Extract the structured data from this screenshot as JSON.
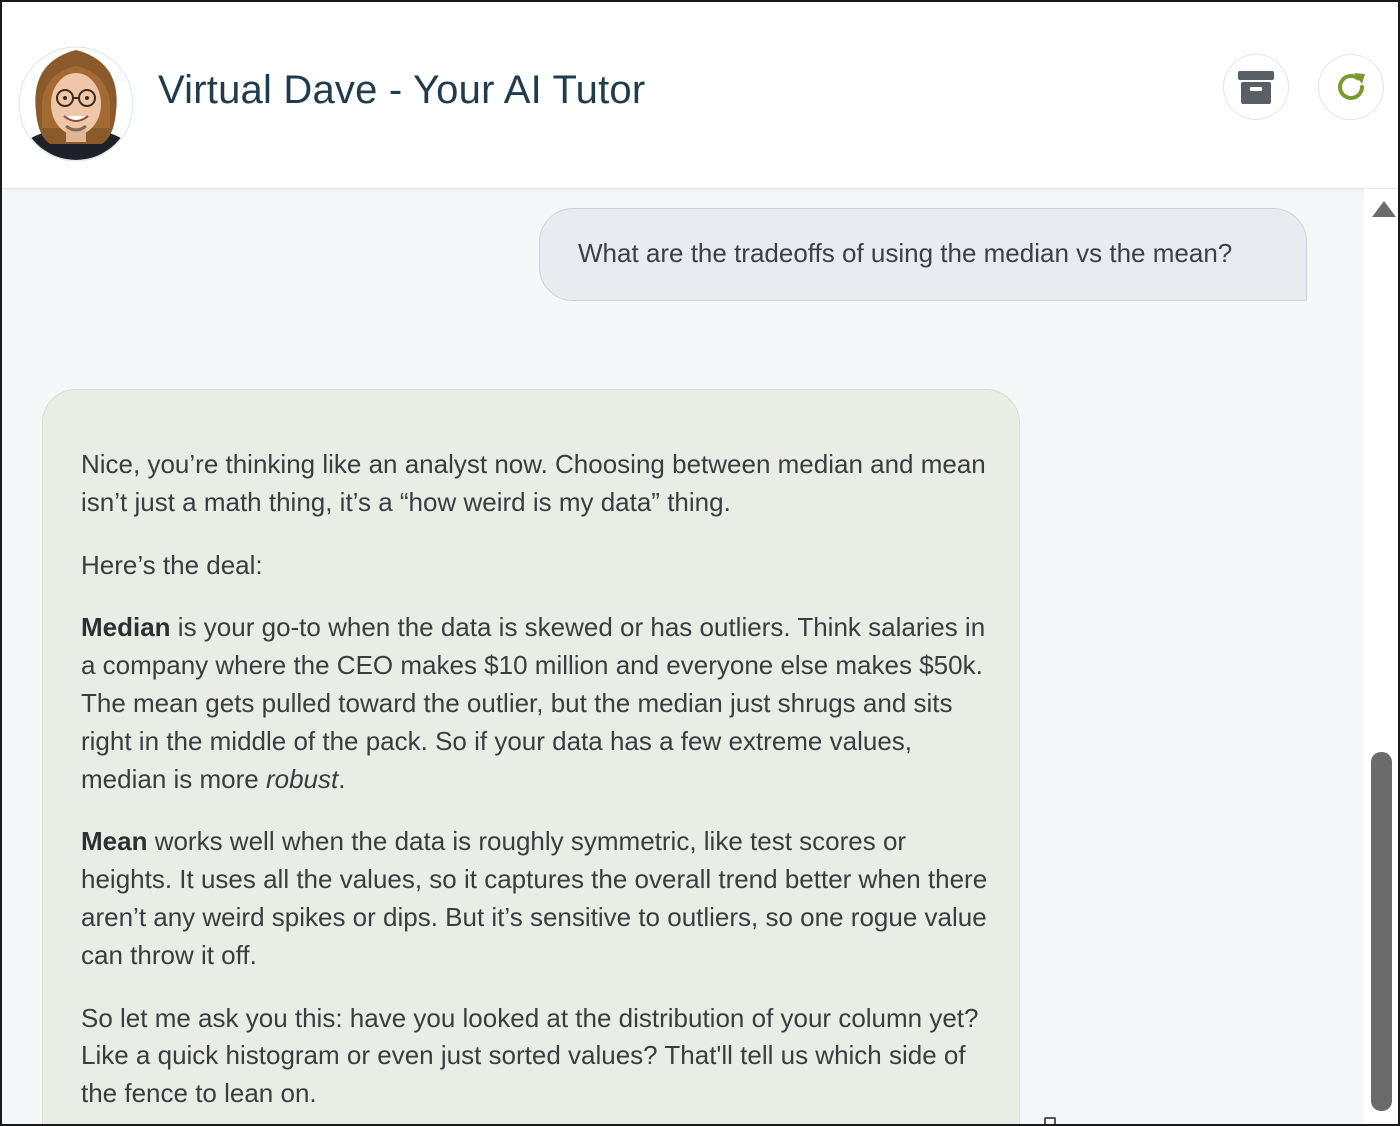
{
  "header": {
    "title": "Virtual Dave - Your AI Tutor",
    "avatar_icon": "tutor-avatar",
    "archive_icon": "archive-icon",
    "refresh_icon": "refresh-icon",
    "accent_color": "#7a9a2e"
  },
  "messages": {
    "user": {
      "text": "What are the tradeoffs of using the median vs the mean?"
    },
    "assistant": {
      "p1": "Nice, you’re thinking like an analyst now. Choosing between median and mean isn’t just a math thing, it’s a “how weird is my data” thing.",
      "p2": "Here’s the deal:",
      "p3_bold": "Median",
      "p3_text": " is your go-to when the data is skewed or has outliers. Think salaries in a company where the CEO makes $10 million and everyone else makes $50k. The mean gets pulled toward the outlier, but the median just shrugs and sits right in the middle of the pack. So if your data has a few extreme values, median is more ",
      "p3_italic": "robust",
      "p3_end": ".",
      "p4_bold": "Mean",
      "p4_text": " works well when the data is roughly symmetric, like test scores or heights. It uses all the values, so it captures the overall trend better when there aren’t any weird spikes or dips. But it’s sensitive to outliers, so one rogue value can throw it off.",
      "p5": "So let me ask you this: have you looked at the distribution of your column yet? Like a quick histogram or even just sorted values? That'll tell us which side of the fence to lean on."
    }
  }
}
